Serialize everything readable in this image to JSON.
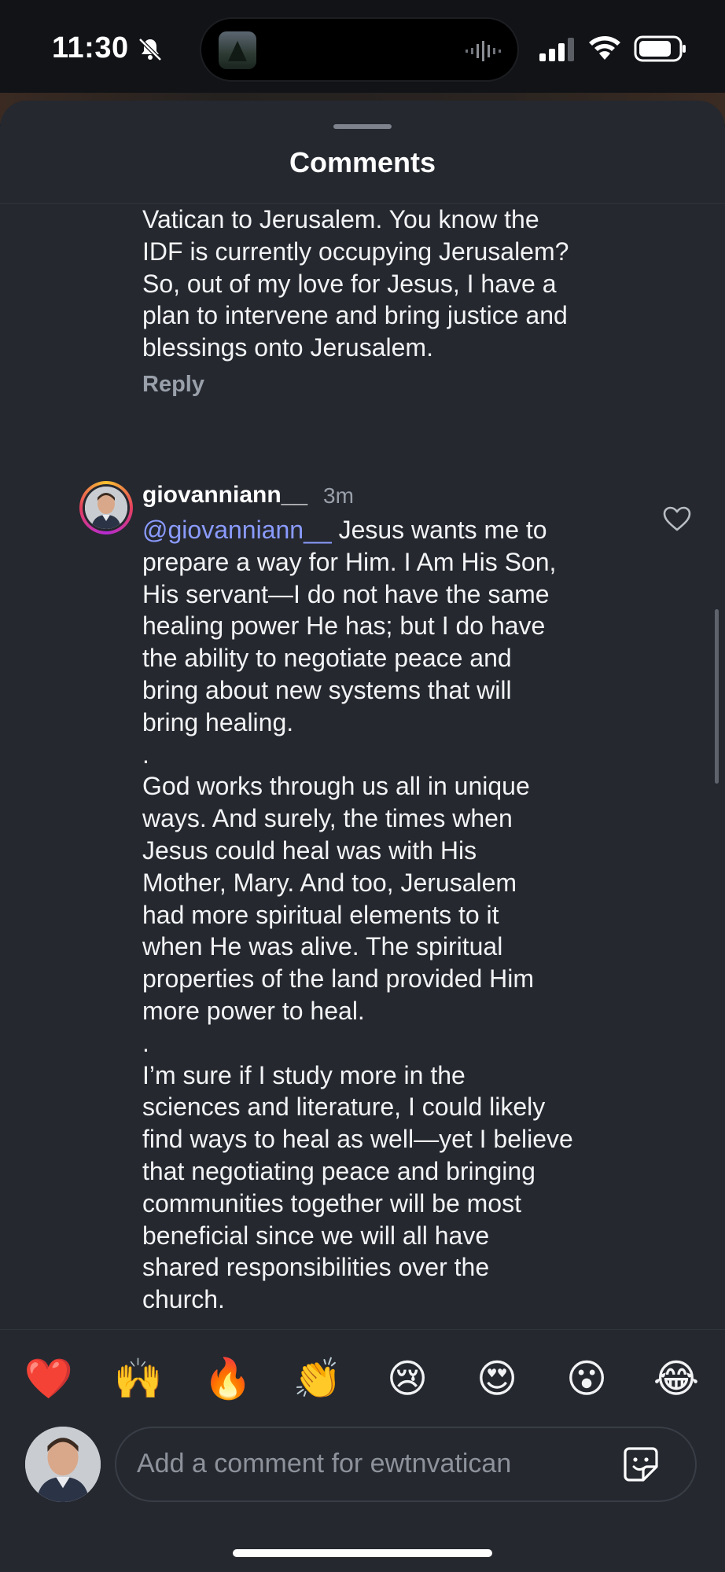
{
  "status_bar": {
    "time": "11:30",
    "icons": [
      "bell-slash-icon",
      "signal-icon",
      "wifi-icon",
      "battery-icon"
    ]
  },
  "sheet": {
    "title": "Comments"
  },
  "previous_comment": {
    "lines": [
      "Vatican to Jerusalem. You know the",
      "IDF is currently occupying Jerusalem?",
      "So, out of my love for Jesus, I have a",
      "plan to intervene and bring justice and",
      "blessings onto Jerusalem."
    ],
    "reply_label": "Reply"
  },
  "comment": {
    "username": "giovanniann__",
    "timestamp": "3m",
    "mention": "@giovanniann__",
    "first_line_rest": " Jesus wants me to",
    "para1_lines": [
      "prepare a way for Him. I Am His Son,",
      "His servant—I do not have the same",
      "healing power He has; but I do have",
      "the ability to negotiate peace and",
      "bring about new systems that will",
      "bring healing."
    ],
    "separator1": ".",
    "para2_lines": [
      "God works through us all in unique",
      "ways. And surely, the times when",
      "Jesus could heal was with His",
      "Mother, Mary. And too, Jerusalem",
      "had more spiritual elements to it",
      "when He was alive. The spiritual",
      "properties of the land provided Him",
      "more power to heal."
    ],
    "separator2": ".",
    "para3_lines": [
      "I’m sure if I study more in the",
      "sciences and literature, I could likely",
      "find ways to heal as well—yet I believe",
      "that negotiating peace and bringing",
      "communities together will be most",
      "beneficial since we will all have",
      "shared responsibilities over the",
      "church."
    ]
  },
  "reactions": [
    "❤️",
    "🙌",
    "🔥",
    "👏",
    "😢",
    "😍",
    "😮",
    "😂"
  ],
  "composer": {
    "placeholder": "Add a comment for ewtnvatican"
  },
  "colors": {
    "background": "#0d0f13",
    "sheet": "#25282f",
    "text": "#f2f3f5",
    "muted": "#9aa0aa",
    "mention": "#8a9bff"
  }
}
